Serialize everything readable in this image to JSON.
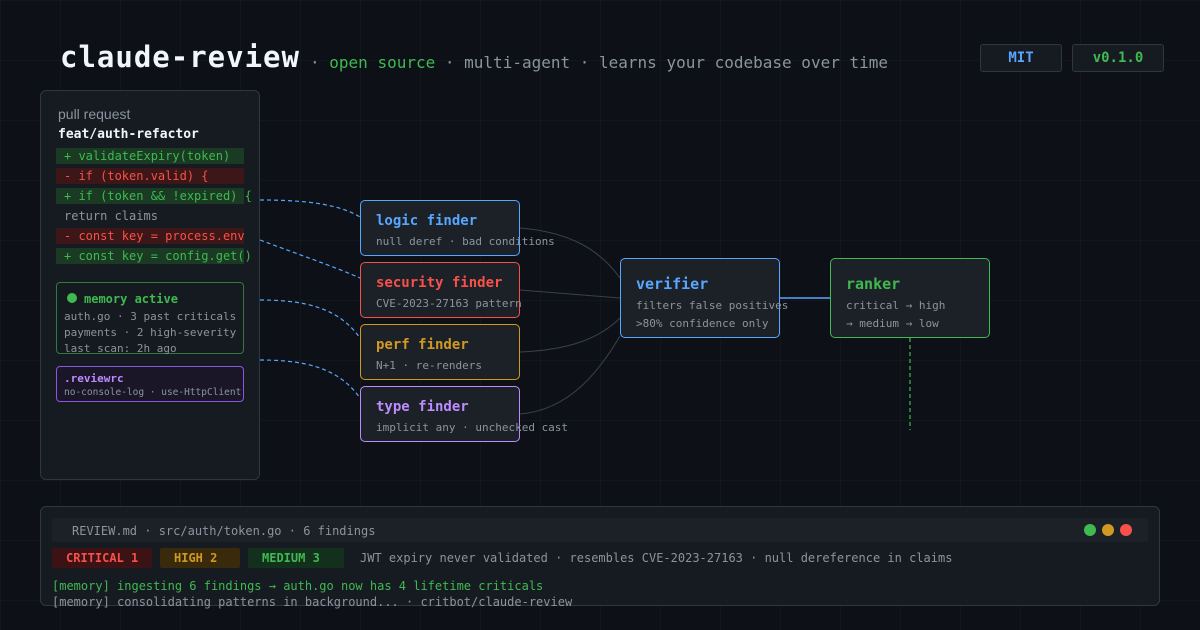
{
  "header": {
    "title": "claude-review",
    "tag_sep1": "·",
    "tag_open_source": "open source",
    "tag_rest": "· multi-agent · learns your codebase over time",
    "license_badge": "MIT",
    "version_badge": "v0.1.0"
  },
  "pr": {
    "heading": "pull request",
    "branch": "feat/auth-refactor",
    "diff_lines": [
      {
        "kind": "add",
        "text": "+ validateExpiry(token)"
      },
      {
        "kind": "del",
        "text": "- if (token.valid) {"
      },
      {
        "kind": "add",
        "text": "+ if (token && !expired) {"
      },
      {
        "kind": "ctx",
        "text": "return claims"
      },
      {
        "kind": "del",
        "text": "- const key = process.env"
      },
      {
        "kind": "add",
        "text": "+ const key = config.get()"
      }
    ]
  },
  "memory": {
    "title": "memory active",
    "lines": [
      "auth.go · 3 past criticals",
      "payments · 2 high-severity",
      "last scan: 2h ago"
    ]
  },
  "reviewrc": {
    "title": ".reviewrc",
    "rules": "no-console-log · use-HttpClient"
  },
  "finders": [
    {
      "title": "logic finder",
      "subtitle": "null deref · bad conditions",
      "color": "#58a6ff"
    },
    {
      "title": "security finder",
      "subtitle": "CVE-2023-27163 pattern",
      "color": "#f85149"
    },
    {
      "title": "perf finder",
      "subtitle": "N+1 · re-renders",
      "color": "#d29922"
    },
    {
      "title": "type finder",
      "subtitle": "implicit any · unchecked cast",
      "color": "#bc8cff"
    }
  ],
  "verifier": {
    "title": "verifier",
    "line1": "filters false positives",
    "line2": ">80% confidence only",
    "color": "#58a6ff"
  },
  "ranker": {
    "title": "ranker",
    "line1": "critical → high",
    "line2": "→ medium → low",
    "color": "#3fb950"
  },
  "output": {
    "file_line": "REVIEW.md · src/auth/token.go · 6 findings",
    "critical": "CRITICAL 1",
    "high": "HIGH 2",
    "medium": "MEDIUM 3",
    "summary": "JWT expiry never validated · resembles CVE-2023-27163 · null dereference in claims",
    "log1": "[memory] ingesting 6 findings → auth.go now has 4 lifetime criticals",
    "log2": "[memory] consolidating patterns in background... · critbot/claude-review",
    "window_dots": [
      "#3fb950",
      "#d29922",
      "#f85149"
    ]
  }
}
